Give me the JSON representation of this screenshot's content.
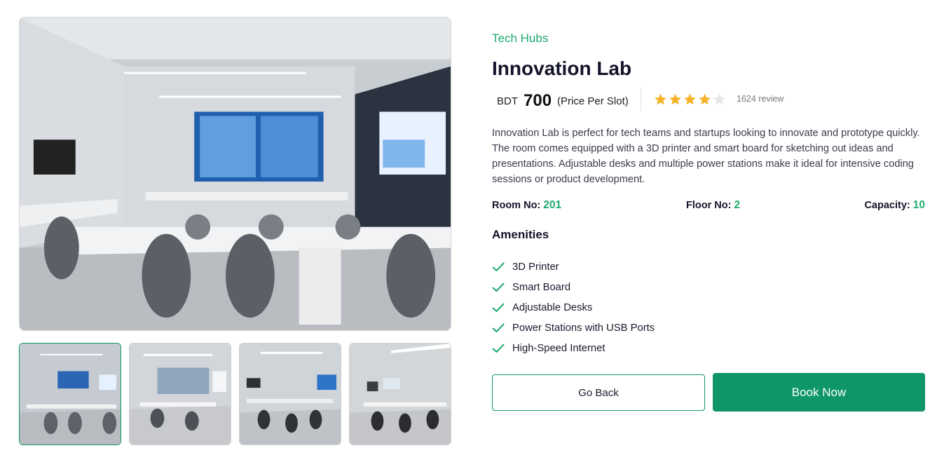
{
  "room": {
    "category": "Tech Hubs",
    "title": "Innovation Lab",
    "currency": "BDT",
    "price": "700",
    "price_unit": "(Price Per Slot)",
    "rating": 4,
    "rating_max": 5,
    "review_text": "1624 review",
    "description": "Innovation Lab is perfect for tech teams and startups looking to innovate and prototype quickly. The room comes equipped with a 3D printer and smart board for sketching out ideas and presentations. Adjustable desks and multiple power stations make it ideal for intensive coding sessions or product development."
  },
  "specs": {
    "room_label": "Room No:",
    "room_value": "201",
    "floor_label": "Floor No:",
    "floor_value": "2",
    "capacity_label": "Capacity:",
    "capacity_value": "10"
  },
  "amenities": {
    "title": "Amenities",
    "items": [
      "3D Printer",
      "Smart Board",
      "Adjustable Desks",
      "Power Stations with USB Ports",
      "High-Speed Internet"
    ]
  },
  "actions": {
    "back_label": "Go Back",
    "book_label": "Book Now"
  },
  "gallery": {
    "count": 4,
    "selected": 0
  },
  "colors": {
    "accent": "#1eaa6e",
    "button": "#0f9668",
    "star": "#f5b32b",
    "star_empty": "#e6e6e6"
  }
}
